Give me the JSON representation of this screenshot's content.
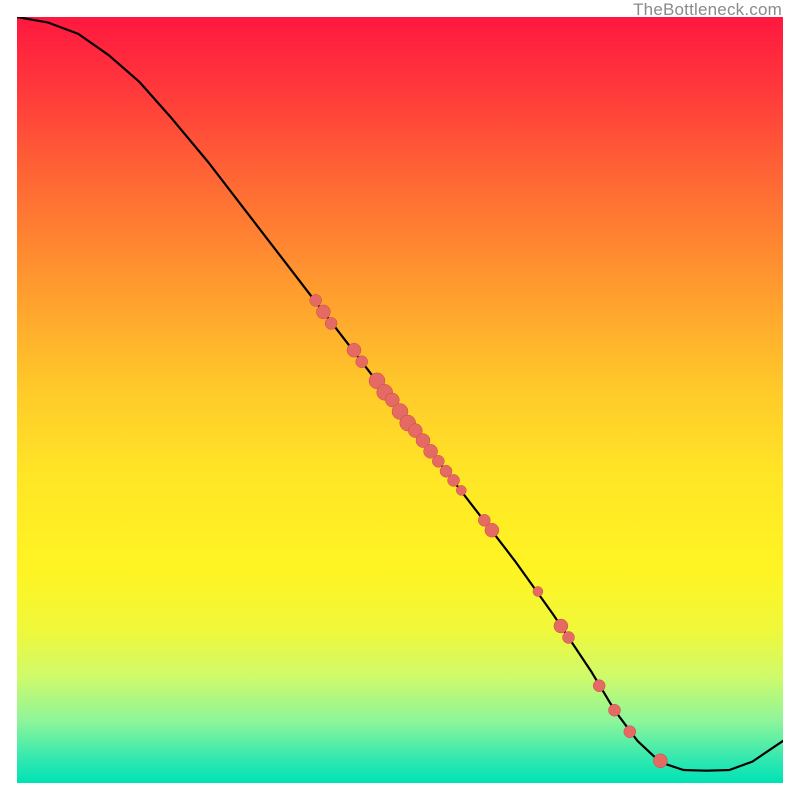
{
  "watermark": "TheBottleneck.com",
  "colors": {
    "curve": "#000000",
    "point_fill": "#e46a63",
    "point_stroke": "#c94b44",
    "gradient_top": "#ff173f",
    "gradient_bottom": "#00e2b5"
  },
  "chart_data": {
    "type": "line",
    "title": "",
    "xlabel": "",
    "ylabel": "",
    "xlim": [
      0,
      100
    ],
    "ylim": [
      0,
      100
    ],
    "curve": [
      {
        "x": 0,
        "y": 100
      },
      {
        "x": 4,
        "y": 99.3
      },
      {
        "x": 8,
        "y": 97.8
      },
      {
        "x": 12,
        "y": 95.0
      },
      {
        "x": 16,
        "y": 91.5
      },
      {
        "x": 20,
        "y": 87.0
      },
      {
        "x": 25,
        "y": 81.0
      },
      {
        "x": 30,
        "y": 74.5
      },
      {
        "x": 35,
        "y": 68.0
      },
      {
        "x": 40,
        "y": 61.5
      },
      {
        "x": 45,
        "y": 55.0
      },
      {
        "x": 50,
        "y": 48.5
      },
      {
        "x": 55,
        "y": 42.0
      },
      {
        "x": 60,
        "y": 35.5
      },
      {
        "x": 65,
        "y": 29.0
      },
      {
        "x": 70,
        "y": 22.0
      },
      {
        "x": 75,
        "y": 14.5
      },
      {
        "x": 78,
        "y": 9.5
      },
      {
        "x": 81,
        "y": 5.5
      },
      {
        "x": 84,
        "y": 2.7
      },
      {
        "x": 87,
        "y": 1.7
      },
      {
        "x": 90,
        "y": 1.6
      },
      {
        "x": 93,
        "y": 1.7
      },
      {
        "x": 96,
        "y": 2.8
      },
      {
        "x": 100,
        "y": 5.5
      }
    ],
    "series": [
      {
        "name": "data-points",
        "points": [
          {
            "x": 39,
            "y": 63,
            "r": 6
          },
          {
            "x": 40,
            "y": 61.5,
            "r": 7
          },
          {
            "x": 41,
            "y": 60,
            "r": 6
          },
          {
            "x": 44,
            "y": 56.5,
            "r": 7
          },
          {
            "x": 45,
            "y": 55,
            "r": 6
          },
          {
            "x": 47,
            "y": 52.5,
            "r": 8
          },
          {
            "x": 48,
            "y": 51,
            "r": 8
          },
          {
            "x": 49,
            "y": 50,
            "r": 7
          },
          {
            "x": 50,
            "y": 48.5,
            "r": 8
          },
          {
            "x": 51,
            "y": 47,
            "r": 8
          },
          {
            "x": 52,
            "y": 46,
            "r": 7
          },
          {
            "x": 53,
            "y": 44.7,
            "r": 7
          },
          {
            "x": 54,
            "y": 43.3,
            "r": 7
          },
          {
            "x": 55,
            "y": 42,
            "r": 6
          },
          {
            "x": 56,
            "y": 40.7,
            "r": 6
          },
          {
            "x": 57,
            "y": 39.5,
            "r": 6
          },
          {
            "x": 58,
            "y": 38.2,
            "r": 5
          },
          {
            "x": 61,
            "y": 34.3,
            "r": 6
          },
          {
            "x": 62,
            "y": 33,
            "r": 7
          },
          {
            "x": 68,
            "y": 25,
            "r": 5
          },
          {
            "x": 71,
            "y": 20.5,
            "r": 7
          },
          {
            "x": 72,
            "y": 19,
            "r": 6
          },
          {
            "x": 76,
            "y": 12.7,
            "r": 6
          },
          {
            "x": 78,
            "y": 9.5,
            "r": 6
          },
          {
            "x": 80,
            "y": 6.7,
            "r": 6
          },
          {
            "x": 84,
            "y": 2.9,
            "r": 7
          }
        ]
      }
    ]
  }
}
